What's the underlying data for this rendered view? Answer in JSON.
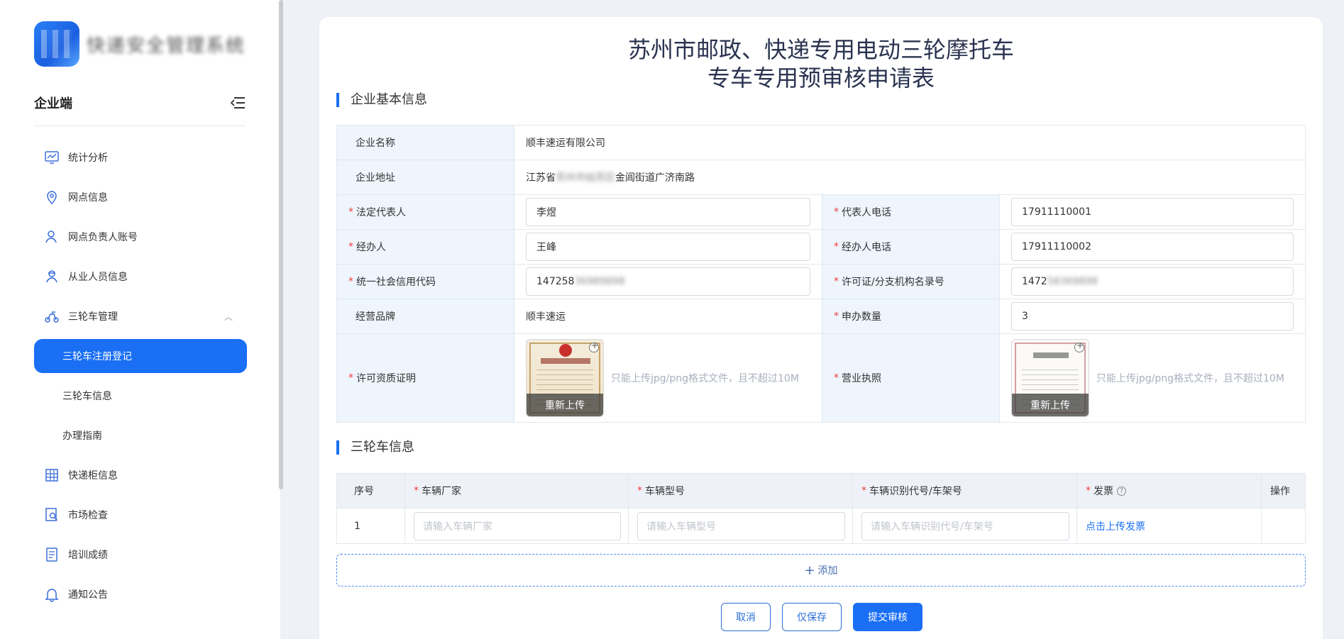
{
  "sidebar": {
    "app_name": "快递安全管理系统",
    "section_title": "企业端",
    "items": [
      {
        "label": "统计分析",
        "icon": "chart-icon"
      },
      {
        "label": "网点信息",
        "icon": "location-icon"
      },
      {
        "label": "网点负责人账号",
        "icon": "user-icon"
      },
      {
        "label": "从业人员信息",
        "icon": "staff-icon"
      },
      {
        "label": "三轮车管理",
        "icon": "tricycle-icon"
      },
      {
        "label": "快递柜信息",
        "icon": "cabinet-icon"
      },
      {
        "label": "市场检查",
        "icon": "inspect-icon"
      },
      {
        "label": "培训成绩",
        "icon": "score-icon"
      },
      {
        "label": "通知公告",
        "icon": "bell-icon"
      }
    ],
    "subitems": [
      {
        "label": "三轮车注册登记",
        "active": true
      },
      {
        "label": "三轮车信息",
        "active": false
      },
      {
        "label": "办理指南",
        "active": false
      }
    ]
  },
  "form": {
    "title_line1": "苏州市邮政、快递专用电动三轮摩托车",
    "title_line2": "专车专用预审核申请表",
    "section1": "企业基本信息",
    "company_name_label": "企业名称",
    "company_name": "顺丰速运有限公司",
    "address_label": "企业地址",
    "address_prefix": "江苏省",
    "address_hidden": "苏州市姑苏区",
    "address_suffix": "金阊街道广济南路",
    "legal_rep_label": "法定代表人",
    "legal_rep": "李煜",
    "rep_phone_label": "代表人电话",
    "rep_phone": "17911110001",
    "agent_label": "经办人",
    "agent": "王峰",
    "agent_phone_label": "经办人电话",
    "agent_phone": "17911110002",
    "credit_code_label": "统一社会信用代码",
    "credit_code_visible": "147258",
    "credit_code_hidden": "36989898",
    "license_no_label": "许可证/分支机构名录号",
    "license_no_visible": "1472",
    "license_no_hidden": "58369898",
    "brand_label": "经营品牌",
    "brand": "顺丰速运",
    "quantity_label": "申办数量",
    "quantity": "3",
    "permit_label": "许可资质证明",
    "license_label": "营业执照",
    "reupload": "重新上传",
    "upload_tip": "只能上传jpg/png格式文件，且不超过10M",
    "section2": "三轮车信息"
  },
  "trike_table": {
    "headers": [
      "序号",
      "车辆厂家",
      "车辆型号",
      "车辆识别代号/车架号",
      "发票",
      "操作"
    ],
    "rows": [
      {
        "index": "1",
        "maker_placeholder": "请输入车辆厂家",
        "model_placeholder": "请输入车辆型号",
        "vin_placeholder": "请输入车辆识别代号/车架号",
        "invoice_link": "点击上传发票"
      }
    ],
    "add_label": "添加"
  },
  "actions": {
    "cancel": "取消",
    "save": "仅保存",
    "submit": "提交审核"
  },
  "colors": {
    "primary": "#1a6ff5",
    "required": "#f23c3c",
    "label_bg": "#eef5fd"
  }
}
